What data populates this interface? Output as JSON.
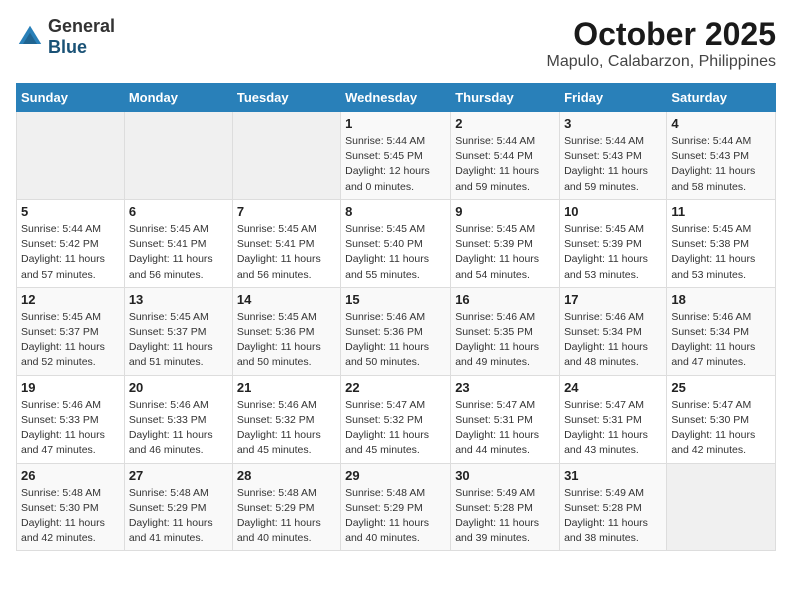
{
  "logo": {
    "general": "General",
    "blue": "Blue"
  },
  "title": "October 2025",
  "location": "Mapulo, Calabarzon, Philippines",
  "days_of_week": [
    "Sunday",
    "Monday",
    "Tuesday",
    "Wednesday",
    "Thursday",
    "Friday",
    "Saturday"
  ],
  "weeks": [
    [
      {
        "day": "",
        "sunrise": "",
        "sunset": "",
        "daylight": ""
      },
      {
        "day": "",
        "sunrise": "",
        "sunset": "",
        "daylight": ""
      },
      {
        "day": "",
        "sunrise": "",
        "sunset": "",
        "daylight": ""
      },
      {
        "day": "1",
        "sunrise": "Sunrise: 5:44 AM",
        "sunset": "Sunset: 5:45 PM",
        "daylight": "Daylight: 12 hours and 0 minutes."
      },
      {
        "day": "2",
        "sunrise": "Sunrise: 5:44 AM",
        "sunset": "Sunset: 5:44 PM",
        "daylight": "Daylight: 11 hours and 59 minutes."
      },
      {
        "day": "3",
        "sunrise": "Sunrise: 5:44 AM",
        "sunset": "Sunset: 5:43 PM",
        "daylight": "Daylight: 11 hours and 59 minutes."
      },
      {
        "day": "4",
        "sunrise": "Sunrise: 5:44 AM",
        "sunset": "Sunset: 5:43 PM",
        "daylight": "Daylight: 11 hours and 58 minutes."
      }
    ],
    [
      {
        "day": "5",
        "sunrise": "Sunrise: 5:44 AM",
        "sunset": "Sunset: 5:42 PM",
        "daylight": "Daylight: 11 hours and 57 minutes."
      },
      {
        "day": "6",
        "sunrise": "Sunrise: 5:45 AM",
        "sunset": "Sunset: 5:41 PM",
        "daylight": "Daylight: 11 hours and 56 minutes."
      },
      {
        "day": "7",
        "sunrise": "Sunrise: 5:45 AM",
        "sunset": "Sunset: 5:41 PM",
        "daylight": "Daylight: 11 hours and 56 minutes."
      },
      {
        "day": "8",
        "sunrise": "Sunrise: 5:45 AM",
        "sunset": "Sunset: 5:40 PM",
        "daylight": "Daylight: 11 hours and 55 minutes."
      },
      {
        "day": "9",
        "sunrise": "Sunrise: 5:45 AM",
        "sunset": "Sunset: 5:39 PM",
        "daylight": "Daylight: 11 hours and 54 minutes."
      },
      {
        "day": "10",
        "sunrise": "Sunrise: 5:45 AM",
        "sunset": "Sunset: 5:39 PM",
        "daylight": "Daylight: 11 hours and 53 minutes."
      },
      {
        "day": "11",
        "sunrise": "Sunrise: 5:45 AM",
        "sunset": "Sunset: 5:38 PM",
        "daylight": "Daylight: 11 hours and 53 minutes."
      }
    ],
    [
      {
        "day": "12",
        "sunrise": "Sunrise: 5:45 AM",
        "sunset": "Sunset: 5:37 PM",
        "daylight": "Daylight: 11 hours and 52 minutes."
      },
      {
        "day": "13",
        "sunrise": "Sunrise: 5:45 AM",
        "sunset": "Sunset: 5:37 PM",
        "daylight": "Daylight: 11 hours and 51 minutes."
      },
      {
        "day": "14",
        "sunrise": "Sunrise: 5:45 AM",
        "sunset": "Sunset: 5:36 PM",
        "daylight": "Daylight: 11 hours and 50 minutes."
      },
      {
        "day": "15",
        "sunrise": "Sunrise: 5:46 AM",
        "sunset": "Sunset: 5:36 PM",
        "daylight": "Daylight: 11 hours and 50 minutes."
      },
      {
        "day": "16",
        "sunrise": "Sunrise: 5:46 AM",
        "sunset": "Sunset: 5:35 PM",
        "daylight": "Daylight: 11 hours and 49 minutes."
      },
      {
        "day": "17",
        "sunrise": "Sunrise: 5:46 AM",
        "sunset": "Sunset: 5:34 PM",
        "daylight": "Daylight: 11 hours and 48 minutes."
      },
      {
        "day": "18",
        "sunrise": "Sunrise: 5:46 AM",
        "sunset": "Sunset: 5:34 PM",
        "daylight": "Daylight: 11 hours and 47 minutes."
      }
    ],
    [
      {
        "day": "19",
        "sunrise": "Sunrise: 5:46 AM",
        "sunset": "Sunset: 5:33 PM",
        "daylight": "Daylight: 11 hours and 47 minutes."
      },
      {
        "day": "20",
        "sunrise": "Sunrise: 5:46 AM",
        "sunset": "Sunset: 5:33 PM",
        "daylight": "Daylight: 11 hours and 46 minutes."
      },
      {
        "day": "21",
        "sunrise": "Sunrise: 5:46 AM",
        "sunset": "Sunset: 5:32 PM",
        "daylight": "Daylight: 11 hours and 45 minutes."
      },
      {
        "day": "22",
        "sunrise": "Sunrise: 5:47 AM",
        "sunset": "Sunset: 5:32 PM",
        "daylight": "Daylight: 11 hours and 45 minutes."
      },
      {
        "day": "23",
        "sunrise": "Sunrise: 5:47 AM",
        "sunset": "Sunset: 5:31 PM",
        "daylight": "Daylight: 11 hours and 44 minutes."
      },
      {
        "day": "24",
        "sunrise": "Sunrise: 5:47 AM",
        "sunset": "Sunset: 5:31 PM",
        "daylight": "Daylight: 11 hours and 43 minutes."
      },
      {
        "day": "25",
        "sunrise": "Sunrise: 5:47 AM",
        "sunset": "Sunset: 5:30 PM",
        "daylight": "Daylight: 11 hours and 42 minutes."
      }
    ],
    [
      {
        "day": "26",
        "sunrise": "Sunrise: 5:48 AM",
        "sunset": "Sunset: 5:30 PM",
        "daylight": "Daylight: 11 hours and 42 minutes."
      },
      {
        "day": "27",
        "sunrise": "Sunrise: 5:48 AM",
        "sunset": "Sunset: 5:29 PM",
        "daylight": "Daylight: 11 hours and 41 minutes."
      },
      {
        "day": "28",
        "sunrise": "Sunrise: 5:48 AM",
        "sunset": "Sunset: 5:29 PM",
        "daylight": "Daylight: 11 hours and 40 minutes."
      },
      {
        "day": "29",
        "sunrise": "Sunrise: 5:48 AM",
        "sunset": "Sunset: 5:29 PM",
        "daylight": "Daylight: 11 hours and 40 minutes."
      },
      {
        "day": "30",
        "sunrise": "Sunrise: 5:49 AM",
        "sunset": "Sunset: 5:28 PM",
        "daylight": "Daylight: 11 hours and 39 minutes."
      },
      {
        "day": "31",
        "sunrise": "Sunrise: 5:49 AM",
        "sunset": "Sunset: 5:28 PM",
        "daylight": "Daylight: 11 hours and 38 minutes."
      },
      {
        "day": "",
        "sunrise": "",
        "sunset": "",
        "daylight": ""
      }
    ]
  ]
}
